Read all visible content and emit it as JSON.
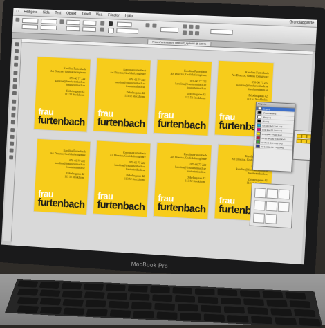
{
  "laptop": {
    "brand_label": "MacBook Pro"
  },
  "menubar": {
    "items": [
      "Redigera",
      "Sida",
      "Text",
      "Objekt",
      "Tabell",
      "Visa",
      "Fönster",
      "Hjälp"
    ],
    "right": [
      "Grundläggande"
    ]
  },
  "document": {
    "tab_title": "FraunFurtenbach_visitkort_ny.indd @ 125%"
  },
  "cards": [
    {
      "name": "Karolina Furtenbach",
      "title": "Art Director, Grafisk formgivare",
      "phone": "070-66 77 222",
      "email": "karolina@fraufurtenbach.se",
      "web": "fraufurtenbach.se",
      "street": "Döbelnsgatan 42",
      "city": "113 52 Stockholm",
      "logo_top": "frau",
      "logo_bottom": "furtenbach"
    }
  ],
  "panel": {
    "title": "Färgrutor",
    "rows": [
      "[Ingen]",
      "[Passmärken]",
      "[Papper]",
      "[Svart]",
      "C=100 M=0 Y=0 K=0",
      "C=0 M=100 Y=0 K=0",
      "C=0 M=0 Y=100 K=0",
      "C=15 M=100 Y=100 K=0",
      "C=75 M=5 Y=100 K=0",
      "C=100 M=90 Y=10 K=0"
    ],
    "swatch_colors": [
      "#ffffff",
      "#000000",
      "#ffffff",
      "#000000",
      "#00aeef",
      "#ec008c",
      "#fff200",
      "#c8102e",
      "#3aaa35",
      "#2b3990"
    ],
    "selected_index": 0
  },
  "colors": {
    "card_yellow": "#f7cc1b",
    "logo_dark": "#1b1b1b",
    "logo_light": "#ffffff"
  }
}
